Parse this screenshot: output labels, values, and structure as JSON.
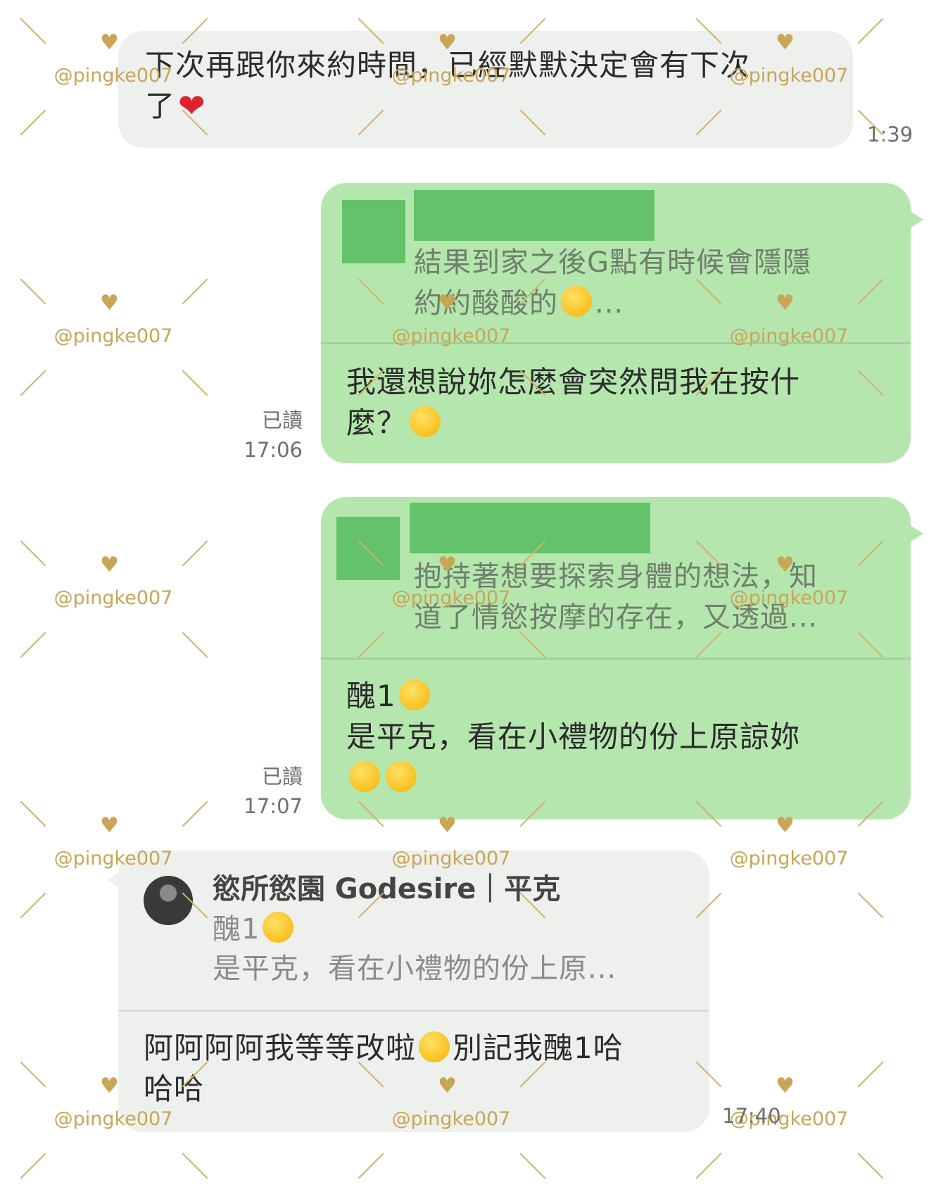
{
  "messages": {
    "m1": {
      "text_line1": "下次再跟你來約時間，已經默默決定會有下次",
      "text_line2": "了",
      "time": "1:39"
    },
    "m2": {
      "quote_line1": "結果到家之後G點有時候會隱隱",
      "quote_line2": "約約酸酸的",
      "quote_ellipsis": "...",
      "text_line1": "我還想說妳怎麼會突然問我在按什",
      "text_line2": "麼？",
      "read": "已讀",
      "time": "17:06"
    },
    "m3": {
      "quote_line1": "抱持著想要探索身體的想法，知",
      "quote_line2": "道了情慾按摩的存在，又透過...",
      "text_line1": "醜1",
      "text_line2": "是平克，看在小禮物的份上原諒妳",
      "read": "已讀",
      "time": "17:07"
    },
    "m4": {
      "sender": "慾所慾園 Godesire｜平克",
      "quote_line1": "醜1",
      "quote_line2": "是平克，看在小禮物的份上原...",
      "text_line1": "阿阿阿阿我等等改啦",
      "text_line1b": "別記我醜1哈",
      "text_line2": "哈哈",
      "time": "17:40"
    }
  },
  "watermark": {
    "text": "@pingke007",
    "color": "#c9a557"
  },
  "colors": {
    "outgoing": "#b5e6ae",
    "incoming": "#eef0ee",
    "redaction": "#64c26a"
  },
  "icons": {
    "heart": "red-heart-emoji",
    "thinking": "thinking-face-emoji",
    "laughing": "rofl-emoji",
    "shush": "shushing-face-emoji",
    "woozy": "woozy-face-emoji",
    "pleading": "pleading-face-emoji"
  }
}
